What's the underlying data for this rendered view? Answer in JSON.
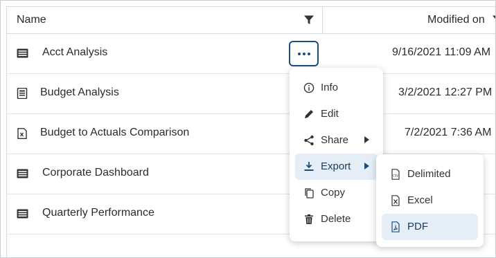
{
  "header": {
    "name_label": "Name",
    "modified_label": "Modified on"
  },
  "rows": [
    {
      "name": "Acct Analysis",
      "modified": "9/16/2021 11:09 AM",
      "icon": "dashboard-icon"
    },
    {
      "name": "Budget Analysis",
      "modified": "3/2/2021 12:27 PM",
      "icon": "report-icon"
    },
    {
      "name": "Budget to Actuals Comparison",
      "modified": "7/2/2021 7:36 AM",
      "icon": "excel-doc-icon"
    },
    {
      "name": "Corporate Dashboard",
      "modified": "",
      "icon": "dashboard-icon"
    },
    {
      "name": "Quarterly Performance",
      "modified": "",
      "icon": "dashboard-icon"
    }
  ],
  "context_menu": {
    "items": [
      {
        "label": "Info",
        "icon": "info-icon"
      },
      {
        "label": "Edit",
        "icon": "pencil-icon"
      },
      {
        "label": "Share",
        "icon": "share-icon",
        "has_submenu": true
      },
      {
        "label": "Export",
        "icon": "download-icon",
        "has_submenu": true,
        "active": true
      },
      {
        "label": "Copy",
        "icon": "copy-icon"
      },
      {
        "label": "Delete",
        "icon": "trash-icon"
      }
    ]
  },
  "export_submenu": {
    "items": [
      {
        "label": "Delimited",
        "icon": "csv-file-icon"
      },
      {
        "label": "Excel",
        "icon": "excel-file-icon"
      },
      {
        "label": "PDF",
        "icon": "pdf-file-icon",
        "active": true
      }
    ]
  },
  "colors": {
    "accent": "#1a4d7c",
    "hover_bg": "#e5eef7",
    "icon": "#333333",
    "border": "#d6d9dd"
  }
}
